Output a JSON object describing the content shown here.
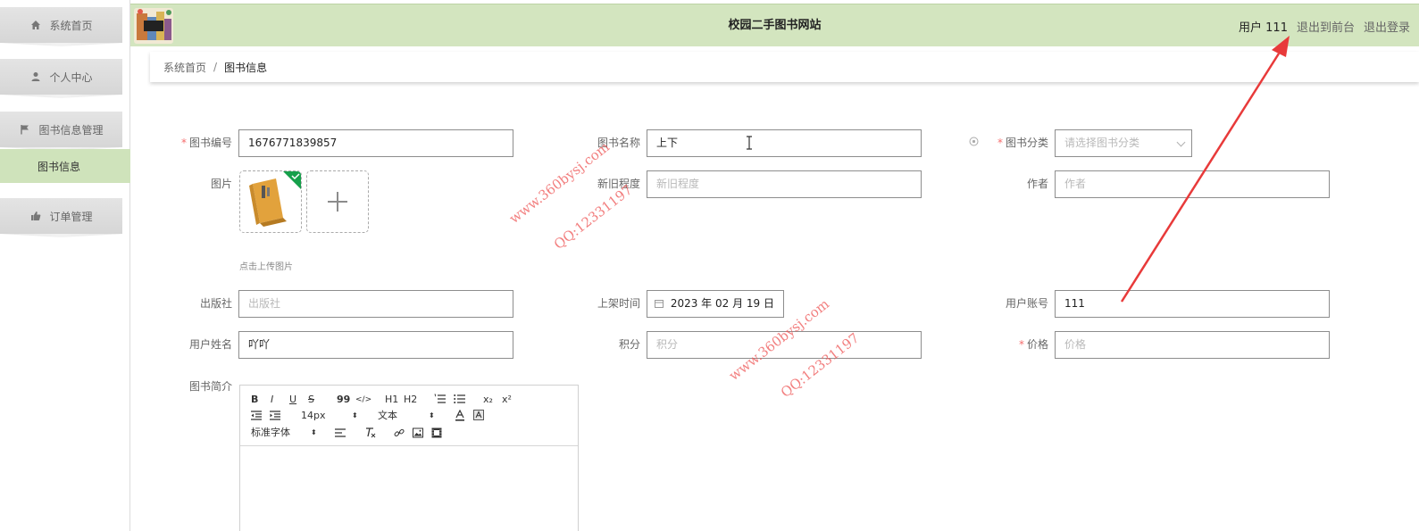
{
  "sidebar": {
    "items": [
      {
        "label": "系统首页",
        "icon": "home-icon"
      },
      {
        "label": "个人中心",
        "icon": "user-icon"
      },
      {
        "label": "图书信息管理",
        "icon": "flag-icon"
      },
      {
        "label": "订单管理",
        "icon": "thumbs-up-icon"
      }
    ],
    "active_subitem": "图书信息"
  },
  "header": {
    "title": "校园二手图书网站",
    "user_label": "用户 111",
    "links": [
      "退出到前台",
      "退出登录"
    ]
  },
  "breadcrumb": {
    "home": "系统首页",
    "separator": "/",
    "current": "图书信息"
  },
  "form": {
    "book_no": {
      "label": "图书编号",
      "value": "1676771839857",
      "required": true
    },
    "book_name": {
      "label": "图书名称",
      "value": "上下",
      "required": false
    },
    "category": {
      "label": "图书分类",
      "placeholder": "请选择图书分类",
      "required": true
    },
    "image": {
      "label": "图片",
      "tip": "点击上传图片"
    },
    "condition": {
      "label": "新旧程度",
      "placeholder": "新旧程度"
    },
    "author": {
      "label": "作者",
      "placeholder": "作者"
    },
    "publisher": {
      "label": "出版社",
      "placeholder": "出版社"
    },
    "listed_time": {
      "label": "上架时间",
      "value": "2023 年 02 月 19 日"
    },
    "user_account": {
      "label": "用户账号",
      "value": "111"
    },
    "user_name": {
      "label": "用户姓名",
      "value": "吖吖"
    },
    "points": {
      "label": "积分",
      "placeholder": "积分"
    },
    "price": {
      "label": "价格",
      "placeholder": "价格",
      "required": true
    },
    "intro": {
      "label": "图书简介"
    }
  },
  "editor": {
    "row1": [
      "B",
      "I",
      "U",
      "S",
      "99",
      "</>",
      "H1",
      "H2",
      "ol",
      "ul",
      "x₂",
      "x²"
    ],
    "font_size": "14px",
    "text_style": "文本",
    "font_family": "标准字体"
  },
  "watermarks": [
    "www.360bysj.com",
    "QQ:12331197"
  ],
  "colors": {
    "header_bg": "#d3e5bf",
    "active_menu_bg": "#cfe3bb",
    "required": "#f56c6c",
    "annotation": "#e83a3a"
  }
}
